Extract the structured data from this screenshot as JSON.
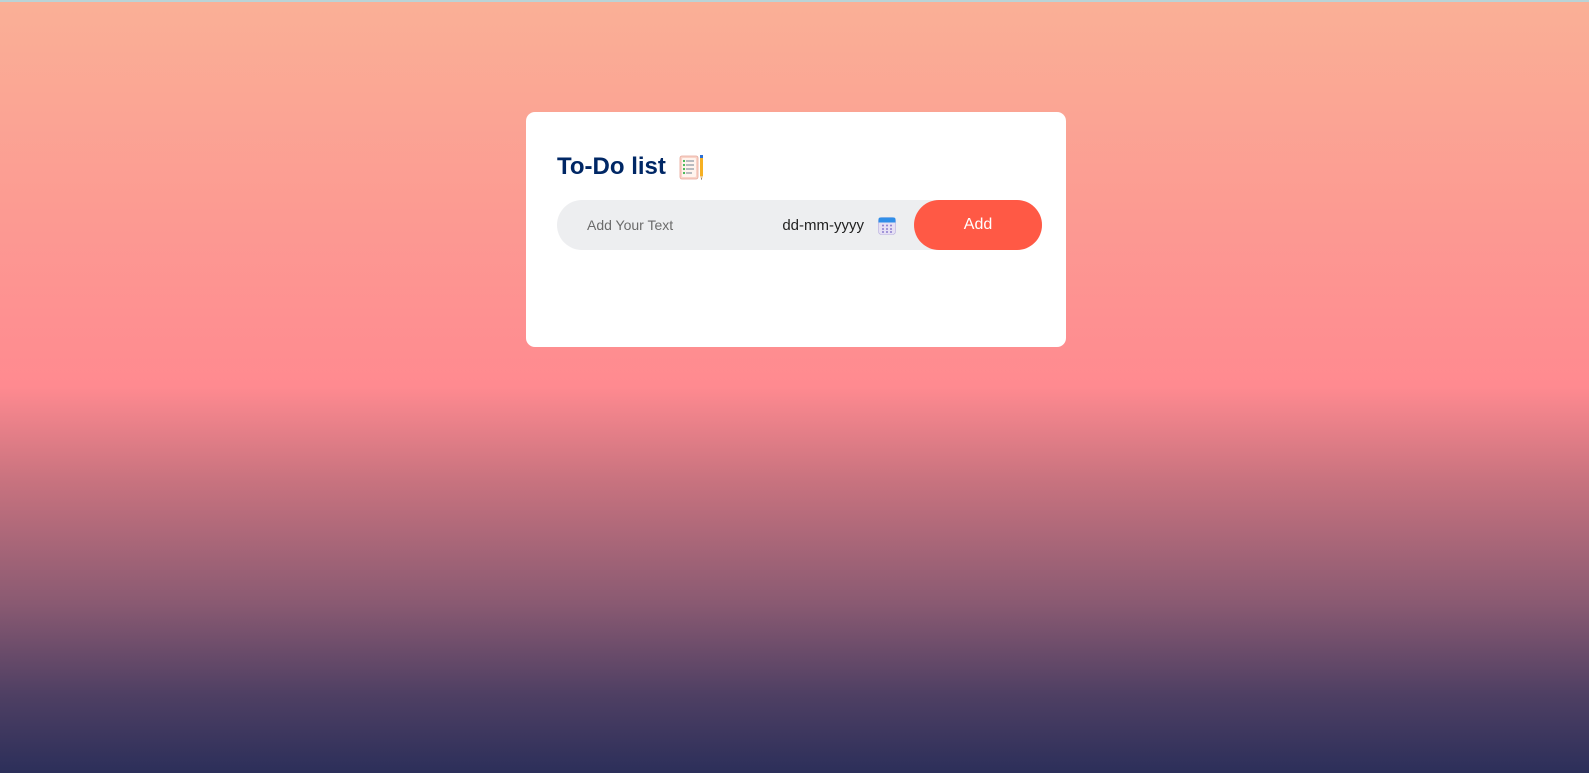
{
  "app": {
    "title": "To-Do list",
    "title_icon": "notepad-pencil-icon"
  },
  "input": {
    "placeholder": "Add Your Text",
    "value": ""
  },
  "date": {
    "placeholder": "dd-mm-yyyy",
    "icon": "calendar-icon"
  },
  "actions": {
    "add_label": "Add"
  },
  "colors": {
    "title": "#002765",
    "add_button": "#ff5945",
    "input_background": "#edeef0",
    "card_background": "#ffffff"
  },
  "todo_items": []
}
